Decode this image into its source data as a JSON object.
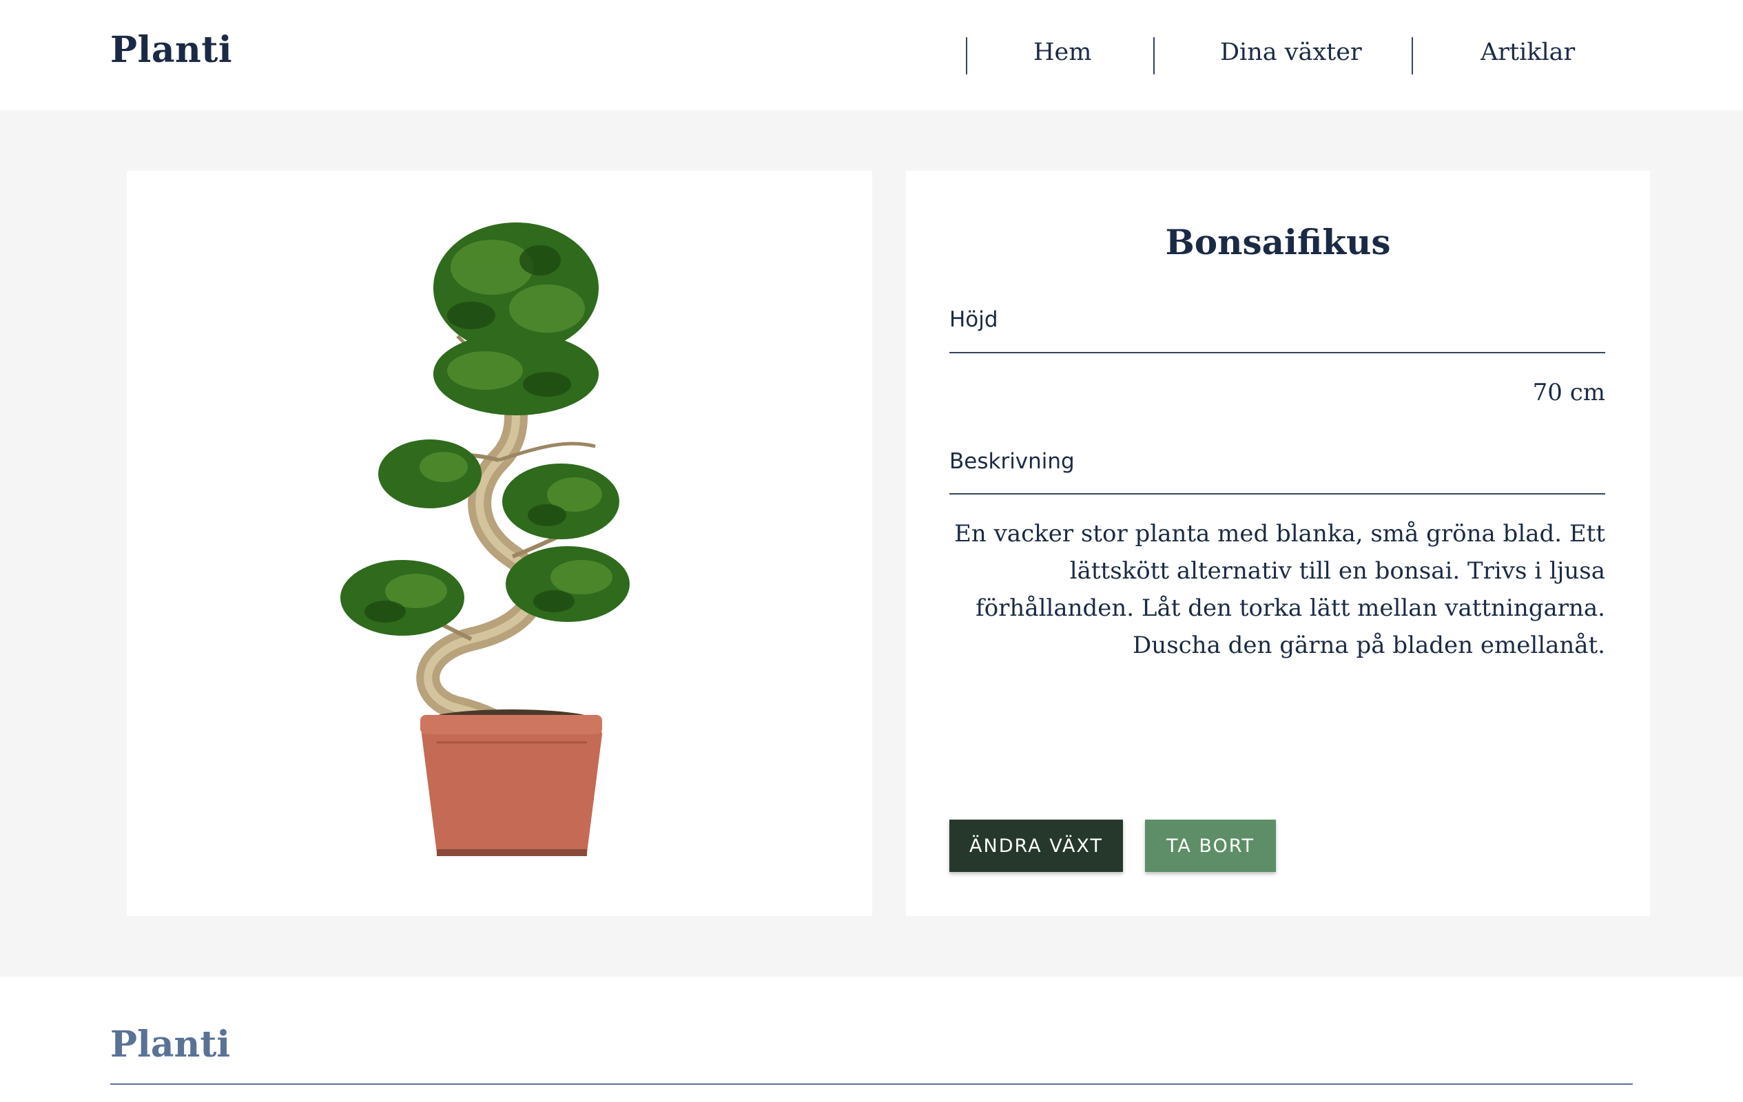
{
  "header": {
    "logo": "Planti",
    "nav": [
      {
        "label": "Hem"
      },
      {
        "label": "Dina växter"
      },
      {
        "label": "Artiklar"
      }
    ]
  },
  "plant": {
    "name": "Bonsaifikus",
    "height_label": "Höjd",
    "height_value": "70 cm",
    "description_label": "Beskrivning",
    "description": "En vacker stor planta med blanka, små gröna blad. Ett lättskött alternativ till en bonsai. Trivs i ljusa förhållanden. Låt den torka lätt mellan vattningarna. Duscha den gärna på bladen emellanåt."
  },
  "actions": {
    "edit_label": "ÄNDRA VÄXT",
    "delete_label": "TA BORT"
  },
  "footer": {
    "logo": "Planti"
  },
  "colors": {
    "navy": "#1b2a44",
    "edit_button": "#26382c",
    "delete_button": "#5e8e67",
    "pot": "#c46a55",
    "background": "#f5f5f5"
  }
}
